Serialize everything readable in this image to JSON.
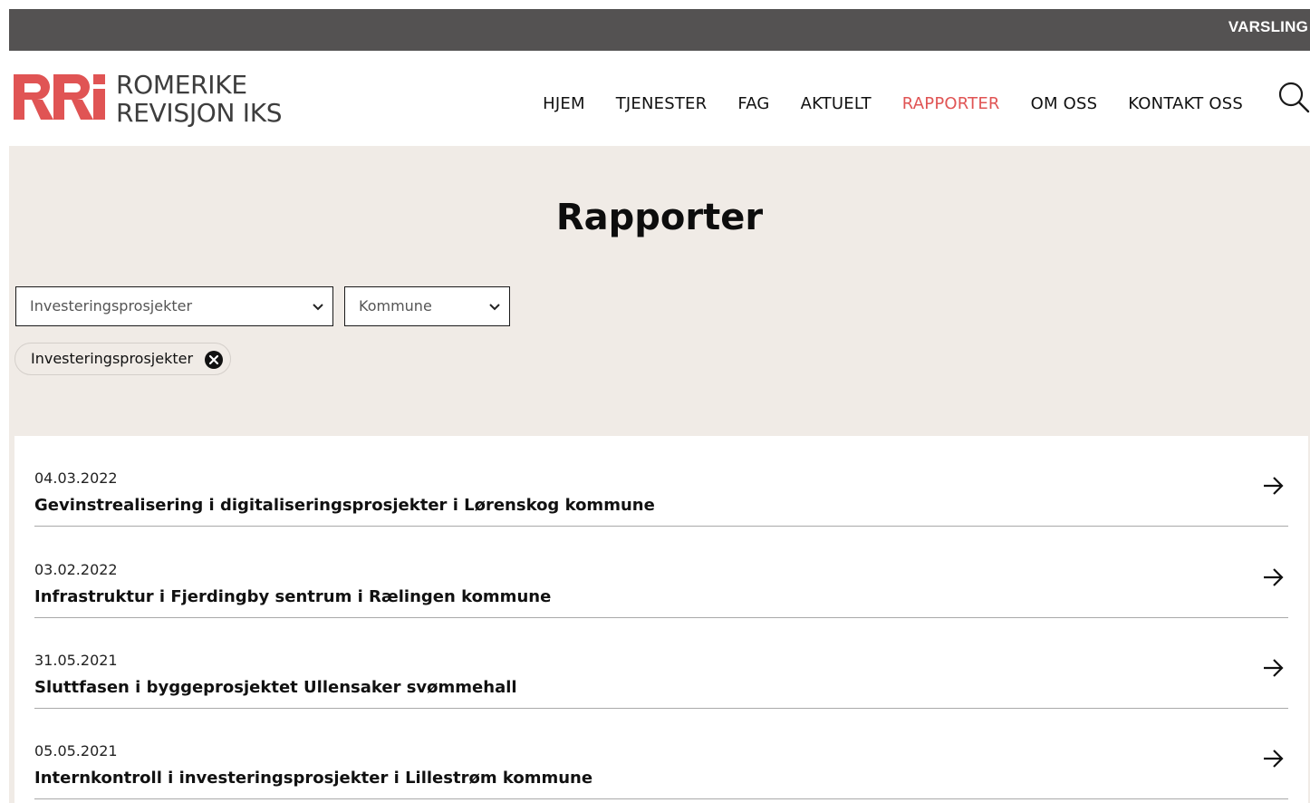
{
  "topbar": {
    "varsling_label": "VARSLING"
  },
  "logo": {
    "line1": "ROMERIKE",
    "line2": "REVISJON IKS",
    "brand_color": "#e05454"
  },
  "nav": {
    "items": [
      {
        "label": "HJEM"
      },
      {
        "label": "TJENESTER"
      },
      {
        "label": "FAG"
      },
      {
        "label": "AKTUELT"
      },
      {
        "label": "RAPPORTER",
        "active": true
      },
      {
        "label": "OM OSS"
      },
      {
        "label": "KONTAKT OSS"
      }
    ],
    "active_color": "#e05454"
  },
  "page": {
    "title": "Rapporter"
  },
  "filters": {
    "category_select": {
      "value": "Investeringsprosjekter"
    },
    "municipality_select": {
      "value": "Kommune"
    },
    "active_chip": {
      "label": "Investeringsprosjekter"
    }
  },
  "reports": [
    {
      "date": "04.03.2022",
      "title": "Gevinstrealisering i digitaliseringsprosjekter i Lørenskog kommune"
    },
    {
      "date": "03.02.2022",
      "title": "Infrastruktur i Fjerdingby sentrum i Rælingen kommune"
    },
    {
      "date": "31.05.2021",
      "title": "Sluttfasen i byggeprosjektet Ullensaker svømmehall"
    },
    {
      "date": "05.05.2021",
      "title": "Internkontroll i investeringsprosjekter i Lillestrøm kommune"
    }
  ],
  "colors": {
    "topbar_bg": "#545252",
    "hero_bg": "#f0ebe6"
  }
}
